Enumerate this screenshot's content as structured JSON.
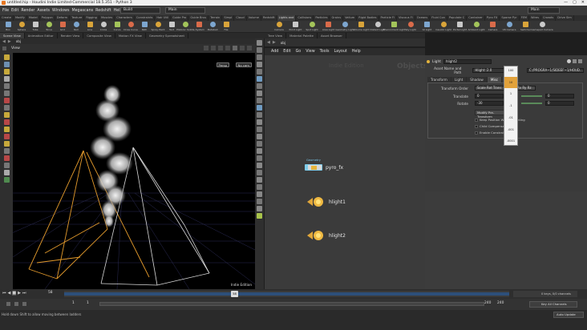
{
  "window": {
    "title": "untitled.hip - Houdini Indie Limited-Commercial 18.5.351 - Python 3",
    "controls": [
      "—",
      "▢",
      "✕"
    ]
  },
  "menubar": {
    "items": [
      "File",
      "Edit",
      "Render",
      "Assets",
      "Windows",
      "Megascans",
      "Redshift",
      "Help"
    ],
    "build_label": "Build",
    "desktop_label": "Main"
  },
  "shelf_tabs": [
    "Create",
    "Modify",
    "Model",
    "Polygon",
    "Deform",
    "Texture",
    "Rigging",
    "Muscles",
    "Characters",
    "Constraints",
    "Hair Util",
    "Guide Pro",
    "Guide Brus",
    "Terrain",
    "Simpl",
    "Cloud",
    "Volume",
    "Redshift",
    "Lights and",
    "Collisions",
    "Particles",
    "Grains",
    "Vellum",
    "Rigid Bodies",
    "Particle Fl",
    "Viscous Fl",
    "Oceans",
    "Fluid Con",
    "Populate C",
    "Container",
    "Pyro FX",
    "Sparse Pyr",
    "FEM",
    "Wires",
    "Crowds",
    "Drive Sim"
  ],
  "left_tools": [
    {
      "name": "Box",
      "icon": "box-icon"
    },
    {
      "name": "Sphere",
      "icon": "sphere-icon"
    },
    {
      "name": "Tube",
      "icon": "tube-icon"
    },
    {
      "name": "Torus",
      "icon": "torus-icon"
    },
    {
      "name": "Grid",
      "icon": "grid-icon"
    },
    {
      "name": "Null",
      "icon": "null-icon"
    },
    {
      "name": "Line",
      "icon": "line-icon"
    },
    {
      "name": "Circle",
      "icon": "circle-icon"
    },
    {
      "name": "Curve",
      "icon": "curve-icon"
    },
    {
      "name": "Draw Curve",
      "icon": "draw-curve-icon"
    },
    {
      "name": "Path",
      "icon": "path-icon"
    },
    {
      "name": "Spray Paint",
      "icon": "spray-paint-icon"
    },
    {
      "name": "Text",
      "icon": "text-icon"
    },
    {
      "name": "Platonic Solids",
      "icon": "platonic-icon"
    },
    {
      "name": "L-System",
      "icon": "lsystem-icon"
    },
    {
      "name": "Metaball",
      "icon": "metaball-icon"
    },
    {
      "name": "File",
      "icon": "file-icon"
    }
  ],
  "right_tools": [
    {
      "name": "Camera",
      "icon": "camera-icon"
    },
    {
      "name": "Point Light",
      "icon": "point-light-icon"
    },
    {
      "name": "Spot Light",
      "icon": "spot-light-icon"
    },
    {
      "name": "Area Light",
      "icon": "area-light-icon"
    },
    {
      "name": "Geometry Light",
      "icon": "geometry-light-icon"
    },
    {
      "name": "Volume Light",
      "icon": "volume-light-icon"
    },
    {
      "name": "Distant Light",
      "icon": "distant-light-icon"
    },
    {
      "name": "Environment Light",
      "icon": "environment-light-icon"
    },
    {
      "name": "Sky Light",
      "icon": "sky-light-icon"
    },
    {
      "name": "GI Light",
      "icon": "gi-light-icon"
    },
    {
      "name": "Caustic Light",
      "icon": "caustic-light-icon"
    },
    {
      "name": "Portal Light",
      "icon": "portal-light-icon"
    },
    {
      "name": "Ambient Light",
      "icon": "ambient-light-icon"
    },
    {
      "name": "Camera",
      "icon": "camera2-icon"
    },
    {
      "name": "VR Camera",
      "icon": "vr-camera-icon"
    },
    {
      "name": "Switcher",
      "icon": "switcher-icon"
    },
    {
      "name": "Gamepad Camera",
      "icon": "gamepad-camera-icon"
    }
  ],
  "left_panetabs": [
    "Scene View",
    "Animation Editor",
    "Render View",
    "Composite View",
    "Motion FX View",
    "Geometry Spreadsheet"
  ],
  "viewport": {
    "path": "obj",
    "view_label": "View",
    "persp_label": "Persp",
    "cam_label": "No cam",
    "watermark": "Indie Edition"
  },
  "net_panetabs": [
    "Tree View",
    "Material Palette",
    "Asset Browser"
  ],
  "network": {
    "path": "obj",
    "menu": [
      "Add",
      "Edit",
      "Go",
      "View",
      "Tools",
      "Layout",
      "Help"
    ],
    "context_label": "Objects",
    "watermark": "Indie Edition",
    "nodes": [
      {
        "name": "pyro_fx",
        "flag": "Geometry"
      },
      {
        "name": "hlight1"
      },
      {
        "name": "hlight2"
      }
    ]
  },
  "params": {
    "node_type": "Light",
    "node_name": "hlight2",
    "asset_label": "Asset Name and Path",
    "asset_value": "Hlight::2.0",
    "asset_path": "C:/PROGRA~1/SIDEEF~1/HOUD...",
    "tabs": [
      "Transform",
      "Light",
      "Shadow",
      "Misc"
    ],
    "active_tab": "Misc",
    "rows": [
      {
        "label": "Transform Order",
        "value": "Scale Rot Trans",
        "value2": "Rx Ry Rz"
      },
      {
        "label": "Translate",
        "value": "0",
        "value2": "0"
      },
      {
        "label": "Rotate",
        "value": "-30",
        "value2": "0"
      }
    ],
    "modify_label": "Modify Pre-Transform",
    "checks": [
      "Keep Position When Parenting",
      "Child Compensation",
      "Enable Constraints"
    ]
  },
  "dropdown": {
    "items": [
      "100",
      "10",
      "1",
      ".1",
      ".01",
      ".001",
      ".0001"
    ],
    "selected": "10"
  },
  "timeline": {
    "frame": "58",
    "frame_marker": "58",
    "start": "1",
    "start2": "1",
    "end": "240",
    "end2": "240",
    "keys_label": "0 keys, 0/0 channels",
    "key_all_label": "Key All Channels",
    "auto_update": "Auto Update"
  },
  "status": {
    "text": "Hold down Shift to allow moving between ladders"
  }
}
